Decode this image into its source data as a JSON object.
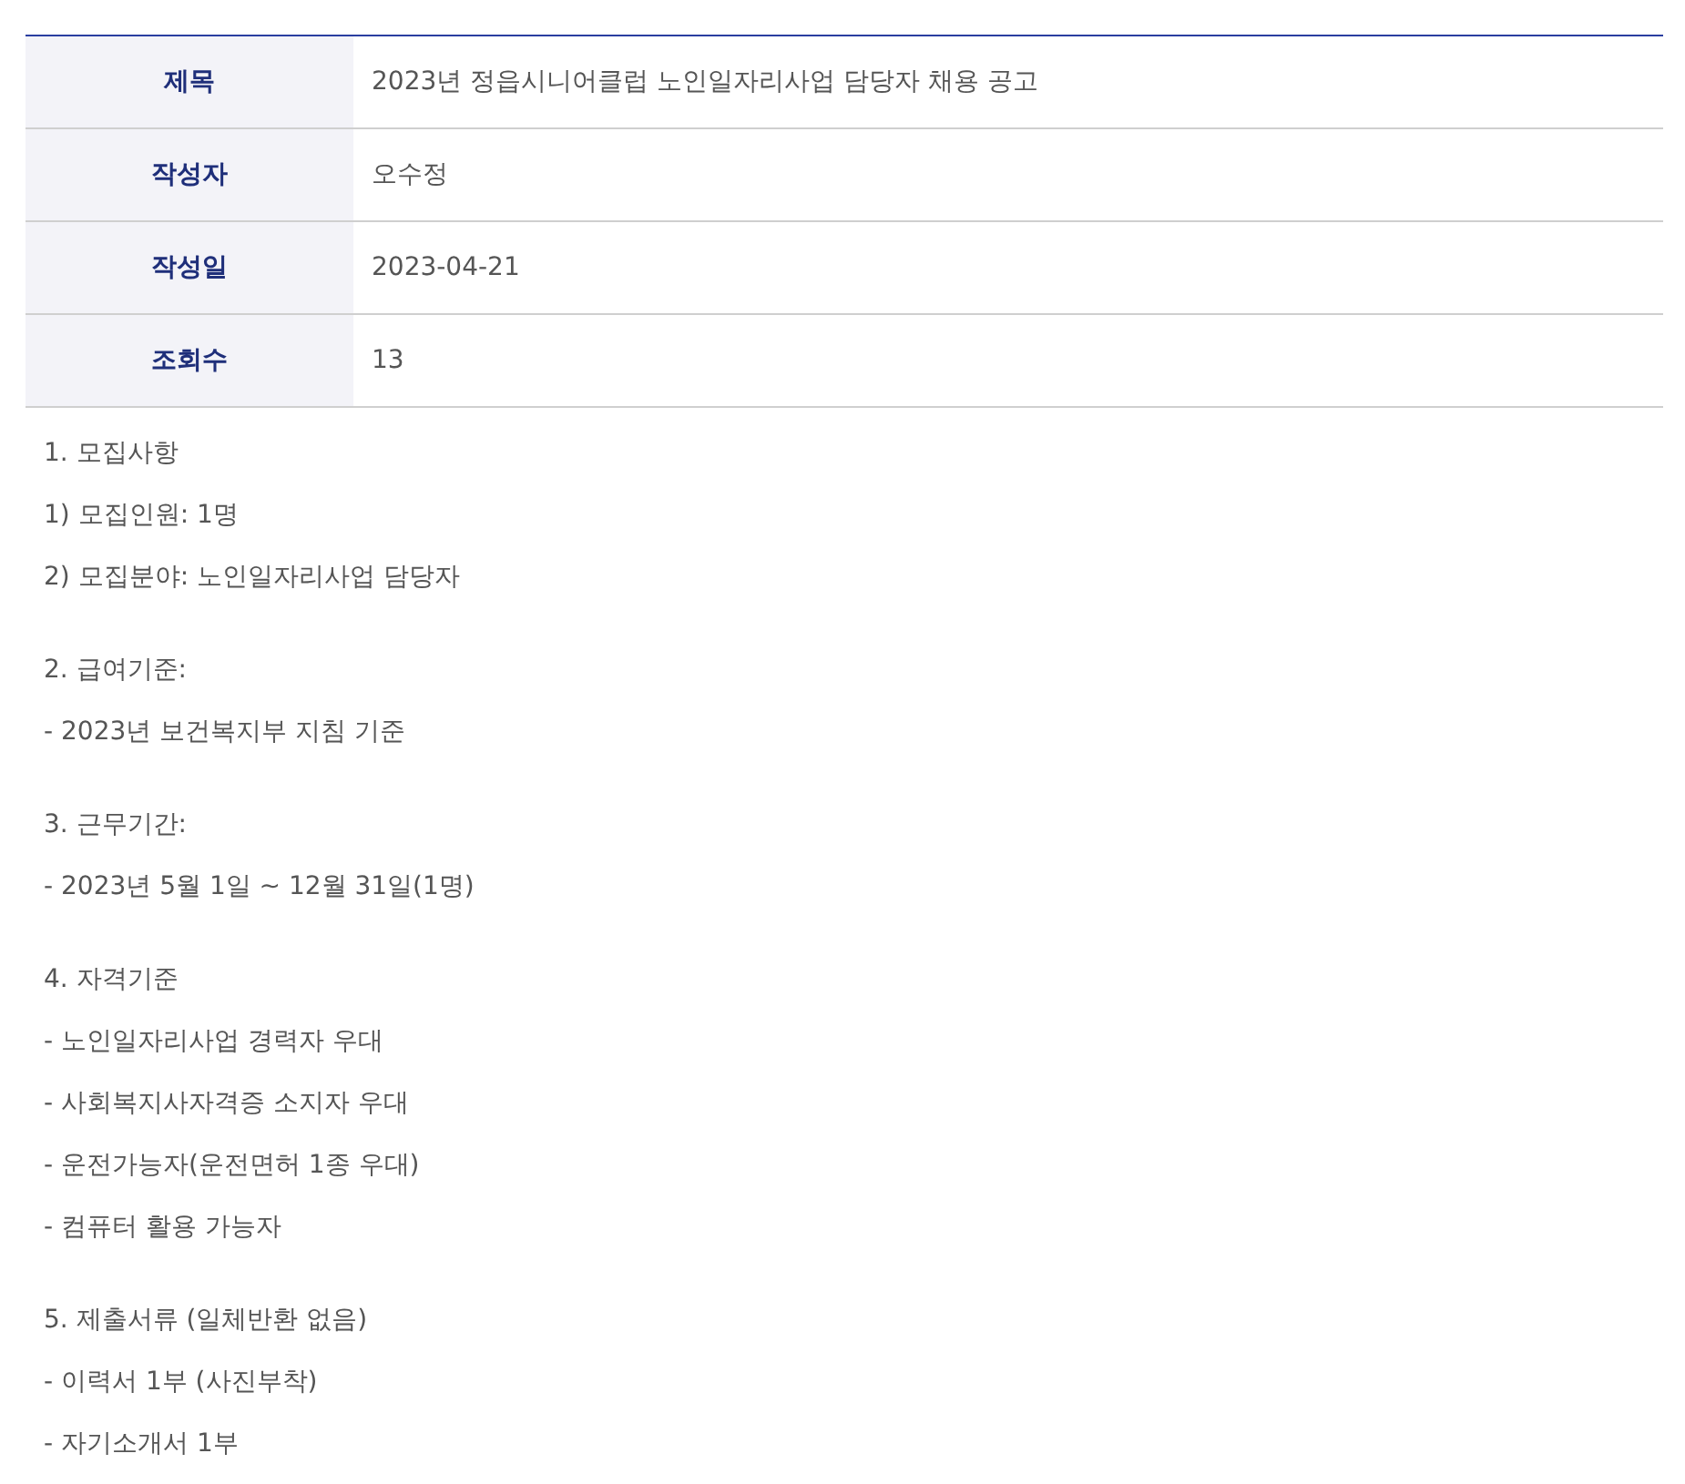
{
  "info_table": [
    {
      "label": "제목",
      "value": "2023년 정읍시니어클럽 노인일자리사업 담당자 채용 공고"
    },
    {
      "label": "작성자",
      "value": "오수정"
    },
    {
      "label": "작성일",
      "value": "2023-04-21"
    },
    {
      "label": "조회수",
      "value": "13"
    }
  ],
  "body": [
    {
      "lines": [
        "1. 모집사항",
        "1) 모집인원: 1명",
        "2) 모집분야: 노인일자리사업 담당자"
      ]
    },
    {
      "lines": [
        "2. 급여기준:",
        "- 2023년 보건복지부 지침 기준"
      ]
    },
    {
      "lines": [
        "3. 근무기간:",
        "- 2023년 5월 1일 ~ 12월 31일(1명)"
      ]
    },
    {
      "lines": [
        "4. 자격기준",
        "- 노인일자리사업 경력자 우대",
        "- 사회복지사자격증 소지자 우대",
        "- 운전가능자(운전면허 1종 우대)",
        "- 컴퓨터 활용 가능자"
      ]
    },
    {
      "lines": [
        "5. 제출서류 (일체반환 없음)",
        "- 이력서 1부 (사진부착)",
        "- 자기소개서 1부"
      ]
    }
  ]
}
